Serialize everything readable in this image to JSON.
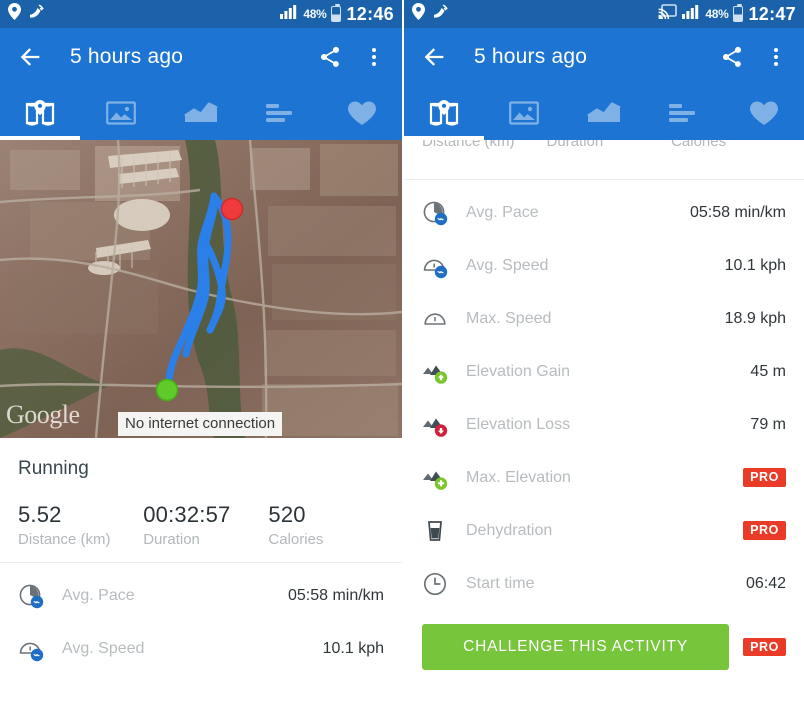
{
  "colors": {
    "statusbar": "#1b62ab",
    "appbar": "#1d74d2",
    "pro_badge": "#ea3b28",
    "cta_green": "#76c53a",
    "track_blue": "#2a7fe8",
    "start_marker": "#5ecb2a",
    "end_marker": "#f03b3b"
  },
  "left": {
    "statusbar": {
      "icons": [
        "location-pin-icon",
        "gps-satellite-icon"
      ],
      "signal": "signal-bars-icon",
      "battery_pct": "48%",
      "battery": "battery-icon",
      "clock": "12:46"
    },
    "appbar": {
      "back": "back-arrow-icon",
      "title": "5 hours ago",
      "share": "share-icon",
      "overflow": "more-vert-icon"
    },
    "tabs": [
      {
        "name": "map",
        "icon": "map-pin-book-icon",
        "active": true
      },
      {
        "name": "photos",
        "icon": "image-icon",
        "active": false
      },
      {
        "name": "graphs",
        "icon": "line-chart-icon",
        "active": false
      },
      {
        "name": "splits",
        "icon": "bar-list-icon",
        "active": false
      },
      {
        "name": "heart-rate",
        "icon": "heart-icon",
        "active": false
      }
    ],
    "map": {
      "watermark": "Google",
      "toast": "No internet connection",
      "start_marker": "start-marker",
      "end_marker": "end-marker"
    },
    "summary": {
      "sport": "Running",
      "kpis": [
        {
          "value": "5.52",
          "label": "Distance (km)"
        },
        {
          "value": "00:32:57",
          "label": "Duration"
        },
        {
          "value": "520",
          "label": "Calories"
        }
      ]
    },
    "rows": [
      {
        "icon": "avg-pace-icon",
        "label": "Avg. Pace",
        "value": "05:58 min/km",
        "pro": false
      },
      {
        "icon": "avg-speed-icon",
        "label": "Avg. Speed",
        "value": "10.1 kph",
        "pro": false
      }
    ]
  },
  "right": {
    "statusbar": {
      "icons": [
        "location-pin-icon",
        "gps-satellite-icon"
      ],
      "cast": "cast-icon",
      "signal": "signal-bars-icon",
      "battery_pct": "48%",
      "battery": "battery-icon",
      "clock": "12:47"
    },
    "appbar": {
      "back": "back-arrow-icon",
      "title": "5 hours ago",
      "share": "share-icon",
      "overflow": "more-vert-icon"
    },
    "tabs": [
      {
        "name": "map",
        "icon": "map-pin-book-icon",
        "active": true
      },
      {
        "name": "photos",
        "icon": "image-icon",
        "active": false
      },
      {
        "name": "graphs",
        "icon": "line-chart-icon",
        "active": false
      },
      {
        "name": "splits",
        "icon": "bar-list-icon",
        "active": false
      },
      {
        "name": "heart-rate",
        "icon": "heart-icon",
        "active": false
      }
    ],
    "clipped_header": [
      {
        "label": "Distance (km)"
      },
      {
        "label": "Duration"
      },
      {
        "label": "Calories"
      }
    ],
    "rows": [
      {
        "icon": "avg-pace-icon",
        "label": "Avg. Pace",
        "value": "05:58 min/km",
        "pro": false
      },
      {
        "icon": "avg-speed-icon",
        "label": "Avg. Speed",
        "value": "10.1 kph",
        "pro": false
      },
      {
        "icon": "max-speed-icon",
        "label": "Max. Speed",
        "value": "18.9 kph",
        "pro": false
      },
      {
        "icon": "elevation-gain-icon",
        "label": "Elevation Gain",
        "value": "45 m",
        "pro": false
      },
      {
        "icon": "elevation-loss-icon",
        "label": "Elevation Loss",
        "value": "79 m",
        "pro": false
      },
      {
        "icon": "max-elevation-icon",
        "label": "Max. Elevation",
        "value": "PRO",
        "pro": true
      },
      {
        "icon": "dehydration-icon",
        "label": "Dehydration",
        "value": "PRO",
        "pro": true
      },
      {
        "icon": "clock-icon",
        "label": "Start time",
        "value": "06:42",
        "pro": false
      }
    ],
    "cta": {
      "label": "CHALLENGE THIS ACTIVITY",
      "pro": "PRO"
    }
  }
}
